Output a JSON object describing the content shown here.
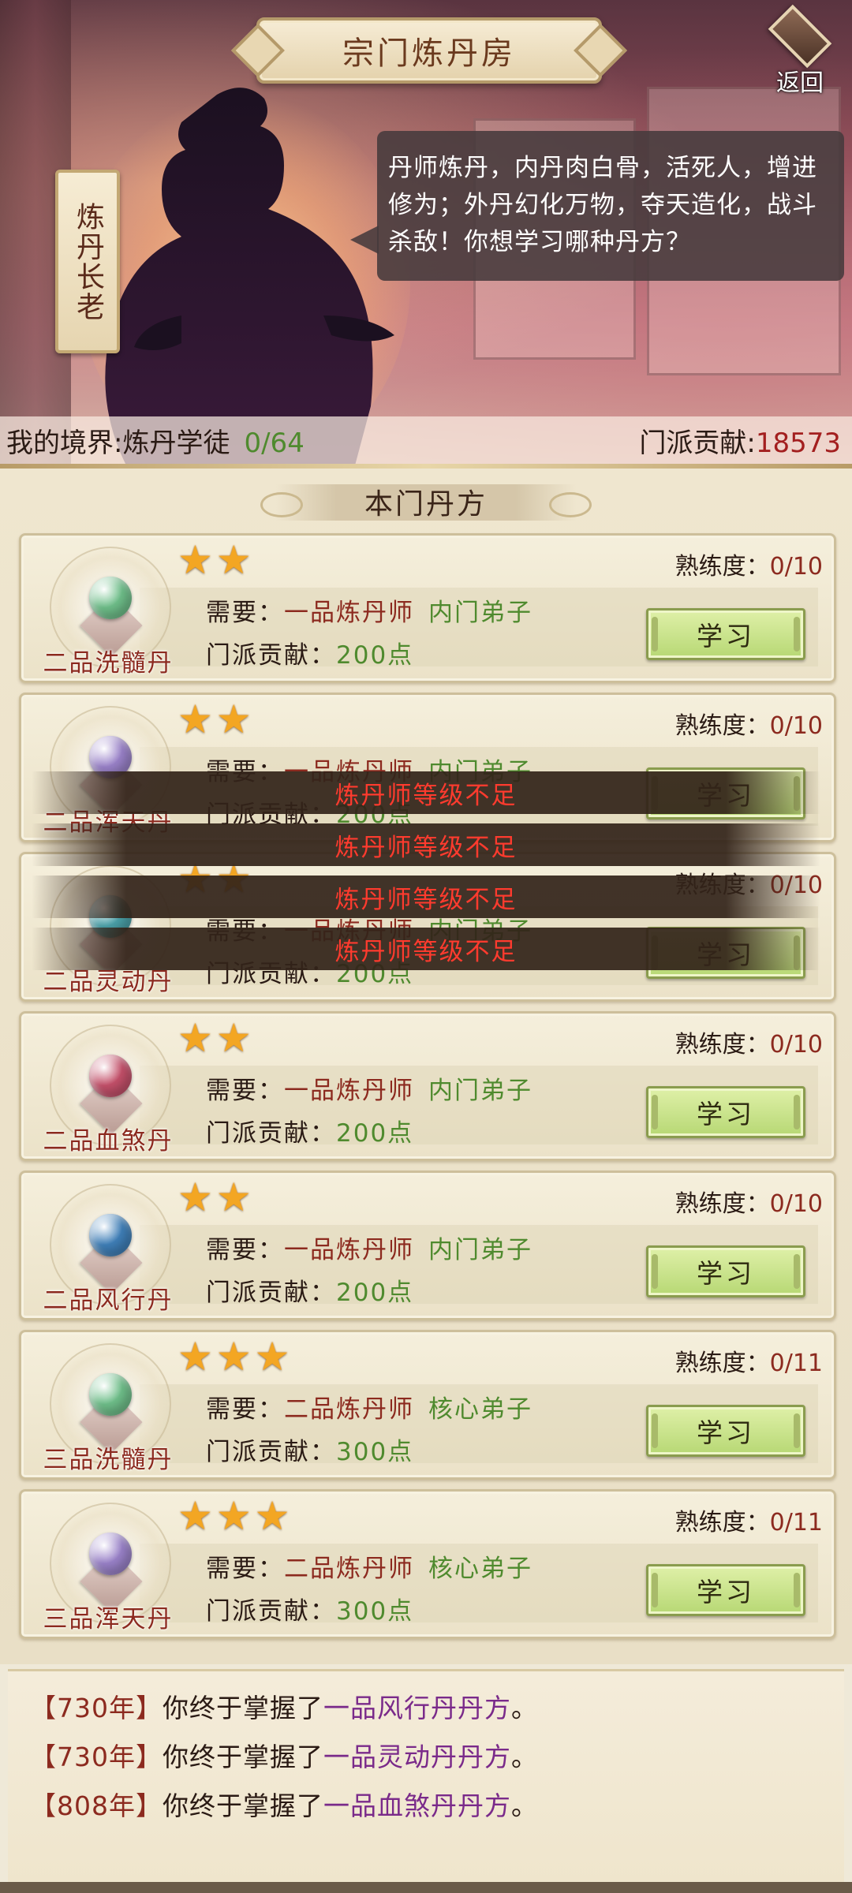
{
  "header": {
    "title": "宗门炼丹房",
    "back_label": "返回",
    "elder_name": "炼丹长老",
    "dialogue": "丹师炼丹，内丹肉白骨，活死人，增进修为；外丹幻化万物，夺天造化，战斗杀敌！你想学习哪种丹方？"
  },
  "status": {
    "realm_label": "我的境界:炼丹学徒",
    "realm_progress": "0/64",
    "contrib_label": "门派贡献:",
    "contrib_value": "18573"
  },
  "section": {
    "title": "本门丹方"
  },
  "labels": {
    "proficiency": "熟练度：",
    "requirement": "需要：",
    "contribution": "门派贡献：",
    "learn": "学习"
  },
  "recipes": [
    {
      "name": "二品洗髓丹",
      "stars": 2,
      "proficiency": "0/10",
      "rank": "一品炼丹师",
      "discipline": "内门弟子",
      "cost": "200点",
      "pill_color": "#6fbf8a",
      "icon": "pill-icon"
    },
    {
      "name": "二品浑天丹",
      "stars": 2,
      "proficiency": "0/10",
      "rank": "一品炼丹师",
      "discipline": "内门弟子",
      "cost": "200点",
      "pill_color": "#9a82c9",
      "icon": "pill-icon"
    },
    {
      "name": "二品灵动丹",
      "stars": 2,
      "proficiency": "0/10",
      "rank": "一品炼丹师",
      "discipline": "内门弟子",
      "cost": "200点",
      "pill_color": "#4aa0a8",
      "icon": "pill-icon"
    },
    {
      "name": "二品血煞丹",
      "stars": 2,
      "proficiency": "0/10",
      "rank": "一品炼丹师",
      "discipline": "内门弟子",
      "cost": "200点",
      "pill_color": "#c4506a",
      "icon": "pill-icon"
    },
    {
      "name": "二品风行丹",
      "stars": 2,
      "proficiency": "0/10",
      "rank": "一品炼丹师",
      "discipline": "内门弟子",
      "cost": "200点",
      "pill_color": "#3f7fb8",
      "icon": "pill-icon"
    },
    {
      "name": "三品洗髓丹",
      "stars": 3,
      "proficiency": "0/11",
      "rank": "二品炼丹师",
      "discipline": "核心弟子",
      "cost": "300点",
      "pill_color": "#6fbf8a",
      "icon": "pill-icon"
    },
    {
      "name": "三品浑天丹",
      "stars": 3,
      "proficiency": "0/11",
      "rank": "二品炼丹师",
      "discipline": "核心弟子",
      "cost": "300点",
      "pill_color": "#9a82c9",
      "icon": "pill-icon"
    }
  ],
  "toasts": [
    "炼丹师等级不足",
    "炼丹师等级不足",
    "炼丹师等级不足",
    "炼丹师等级不足"
  ],
  "log": [
    {
      "year": "【730年】",
      "text": "你终于掌握了",
      "item": "一品风行丹丹方",
      "end": "。"
    },
    {
      "year": "【730年】",
      "text": "你终于掌握了",
      "item": "一品灵动丹丹方",
      "end": "。"
    },
    {
      "year": "【808年】",
      "text": "你终于掌握了",
      "item": "一品血煞丹丹方",
      "end": "。"
    }
  ],
  "colors": {
    "accent_red": "#8c2a1f",
    "accent_green": "#4f8a2e",
    "log_item_purple": "#7a2a8a",
    "toast_text": "#ff3b2e",
    "star": "#f3a623"
  }
}
